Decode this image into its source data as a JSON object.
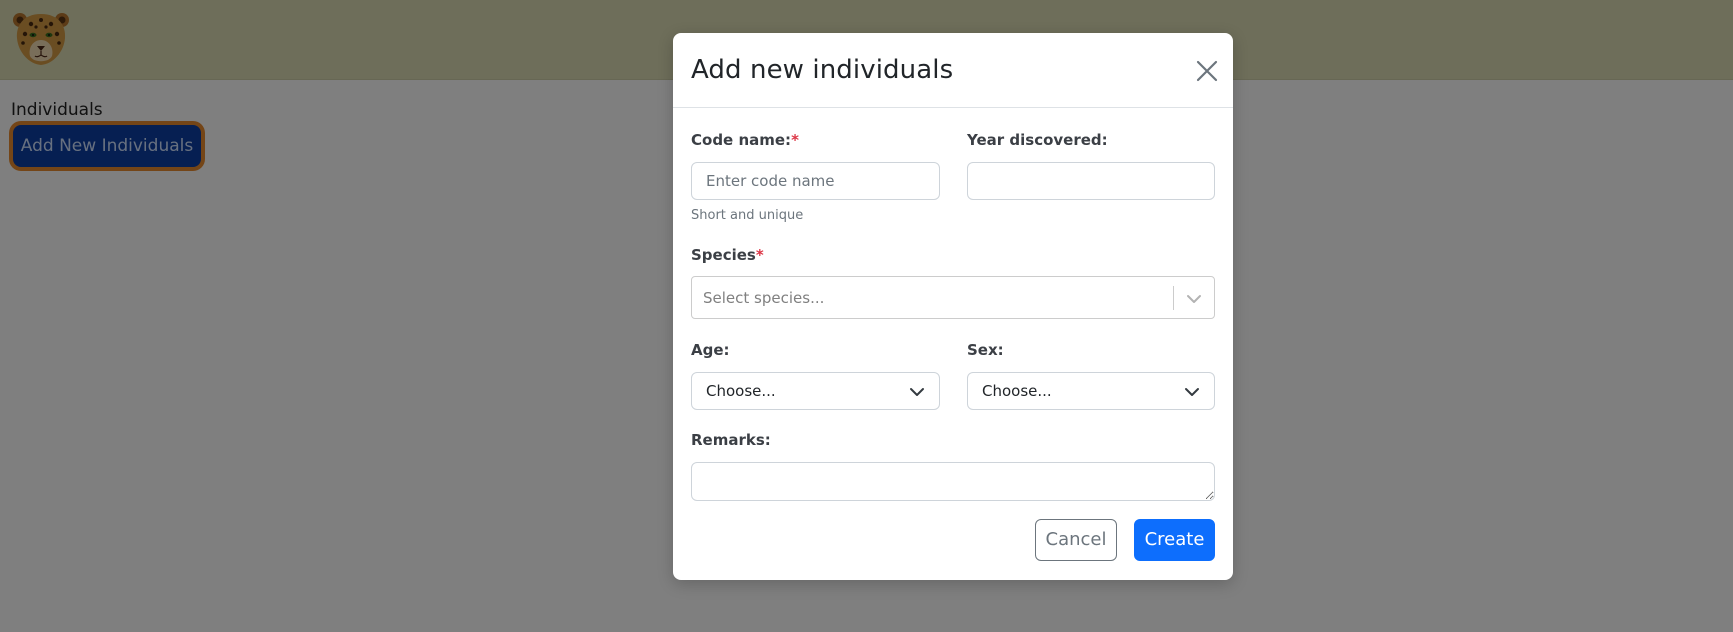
{
  "app": {
    "logo_icon": "jaguar-face-logo",
    "page_heading": "Individuals",
    "add_button_label": "Add New Individuals",
    "accent_highlight": "#e98a2e"
  },
  "modal": {
    "title": "Add new individuals",
    "close_icon": "close-icon",
    "code_name": {
      "label": "Code name:",
      "required_mark": "*",
      "placeholder": "Enter code name",
      "value": "",
      "help": "Short and unique"
    },
    "year_discovered": {
      "label": "Year discovered:",
      "value": ""
    },
    "species": {
      "label": "Species",
      "required_mark": "*",
      "placeholder": "Select species...",
      "icon": "chevron-down-icon"
    },
    "age": {
      "label": "Age:",
      "selected": "Choose...",
      "icon": "chevron-down-icon"
    },
    "sex": {
      "label": "Sex:",
      "selected": "Choose...",
      "icon": "chevron-down-icon"
    },
    "remarks": {
      "label": "Remarks:",
      "value": ""
    },
    "cancel_label": "Cancel",
    "create_label": "Create",
    "primary_color": "#0d6efd"
  }
}
